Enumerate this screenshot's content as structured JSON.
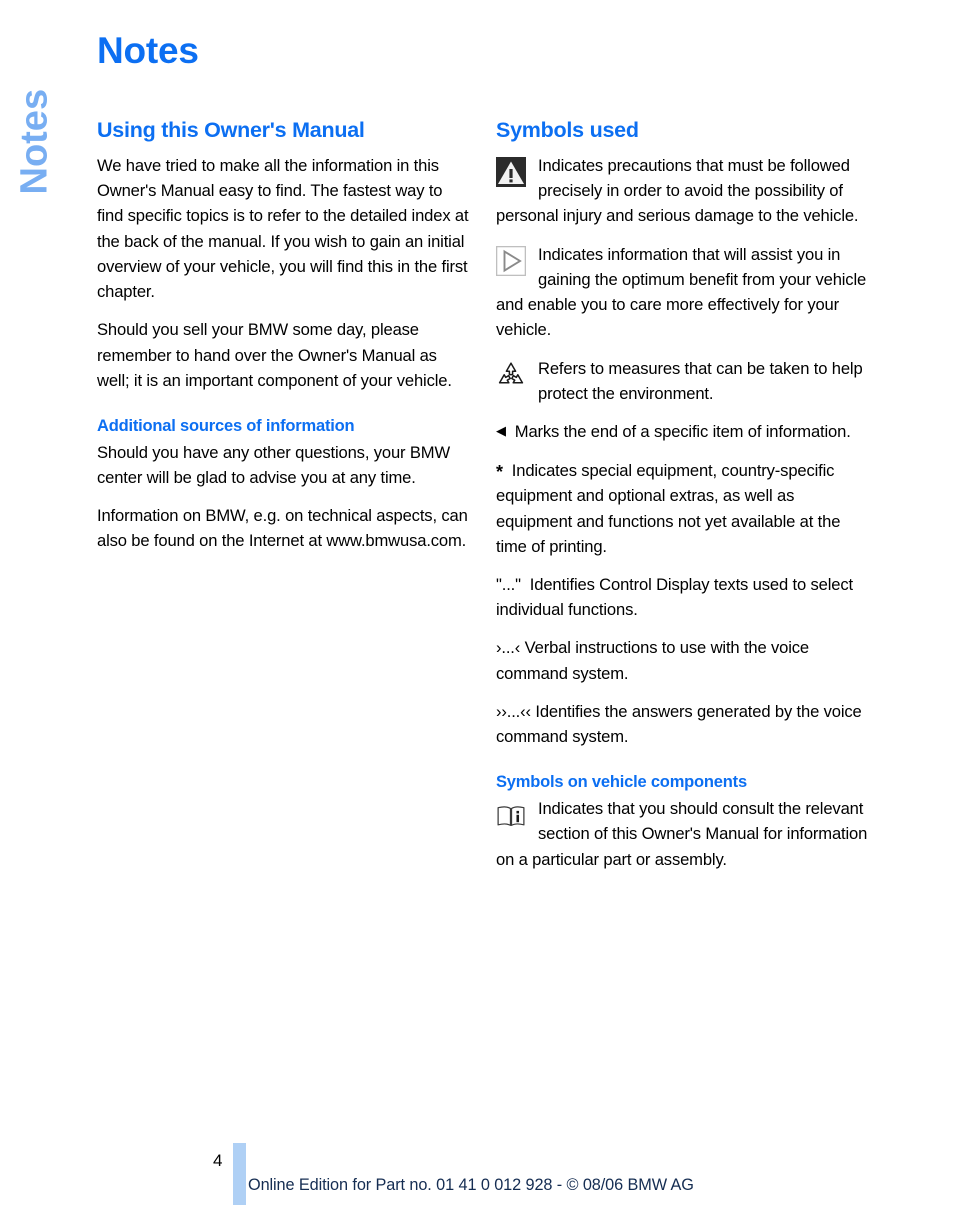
{
  "document": {
    "side_tab_label": "Notes",
    "page_title": "Notes",
    "accent_blue": "#0C6FF2",
    "side_tab_blue": "#78AEF2",
    "footer_bar_blue": "#AFD0F5",
    "footer_text_color": "#152D52"
  },
  "left_column": {
    "heading": "Using this Owner's Manual",
    "paragraph_1": "We have tried to make all the information in this Owner's Manual easy to find. The fastest way to find specific topics is to refer to the detailed index at the back of the manual. If you wish to gain an initial overview of your vehicle, you will find this in the first chapter.",
    "paragraph_2": "Should you sell your BMW some day, please remember to hand over the Owner's Manual as well; it is an important component of your vehicle.",
    "subheading": "Additional sources of information",
    "paragraph_3": "Should you have any other questions, your BMW center will be glad to advise you at any time.",
    "paragraph_4": "Information on BMW, e.g. on technical aspects, can also be found on the Internet at www.bmwusa.com."
  },
  "right_column": {
    "heading": "Symbols used",
    "entries": [
      {
        "icon": "warning-triangle-icon",
        "text": "Indicates precautions that must be followed precisely in order to avoid the possibility of personal injury and serious damage to the vehicle."
      },
      {
        "icon": "play-triangle-info-icon",
        "text": "Indicates information that will assist you in gaining the optimum benefit from your vehicle and enable you to care more effectively for your vehicle."
      },
      {
        "icon": "recycling-icon",
        "text": "Refers to measures that can be taken to help protect the environment."
      }
    ],
    "markers": [
      {
        "symbol": "◀",
        "icon": "left-triangle-marker-icon",
        "text": "Marks the end of a specific item of information."
      },
      {
        "symbol": "*",
        "icon": "asterisk-marker-icon",
        "text": "Indicates special equipment, country-specific equipment and optional extras, as well as equipment and functions not yet available at the time of printing."
      },
      {
        "symbol": "\"...\"",
        "icon": "quotation-marker-icon",
        "text": "Identifies Control Display texts used to select individual functions."
      },
      {
        "symbol": "›...‹",
        "icon": "single-guillemet-marker-icon",
        "text": "Verbal instructions to use with the voice command system."
      },
      {
        "symbol": "››...‹‹",
        "icon": "double-guillemet-marker-icon",
        "text": "Identifies the answers generated by the voice command system."
      }
    ],
    "subheading": "Symbols on vehicle components",
    "vehicle_entry": {
      "icon": "open-book-info-icon",
      "text": "Indicates that you should consult the relevant section of this Owner's Manual for information on a particular part or assembly."
    }
  },
  "footer": {
    "page_number": "4",
    "text": "Online Edition for Part no. 01 41 0 012 928 - © 08/06 BMW AG"
  }
}
